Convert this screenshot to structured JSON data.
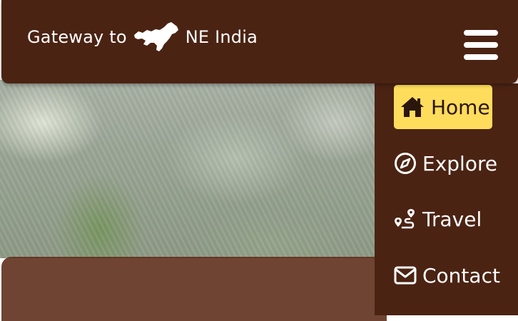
{
  "header": {
    "brand_prefix": "Gateway to",
    "brand_suffix": "NE India",
    "logo_icon": "northeast-india-map-icon",
    "menu_icon": "hamburger-menu-icon"
  },
  "menu": {
    "items": [
      {
        "label": "Home",
        "icon": "home-icon",
        "active": true
      },
      {
        "label": "Explore",
        "icon": "compass-icon",
        "active": false
      },
      {
        "label": "Travel",
        "icon": "route-icon",
        "active": false
      },
      {
        "label": "Contact",
        "icon": "envelope-icon",
        "active": false
      }
    ]
  },
  "colors": {
    "header_bg": "#4b2313",
    "active_item_bg": "#fedc5c",
    "text": "#ffffff"
  }
}
